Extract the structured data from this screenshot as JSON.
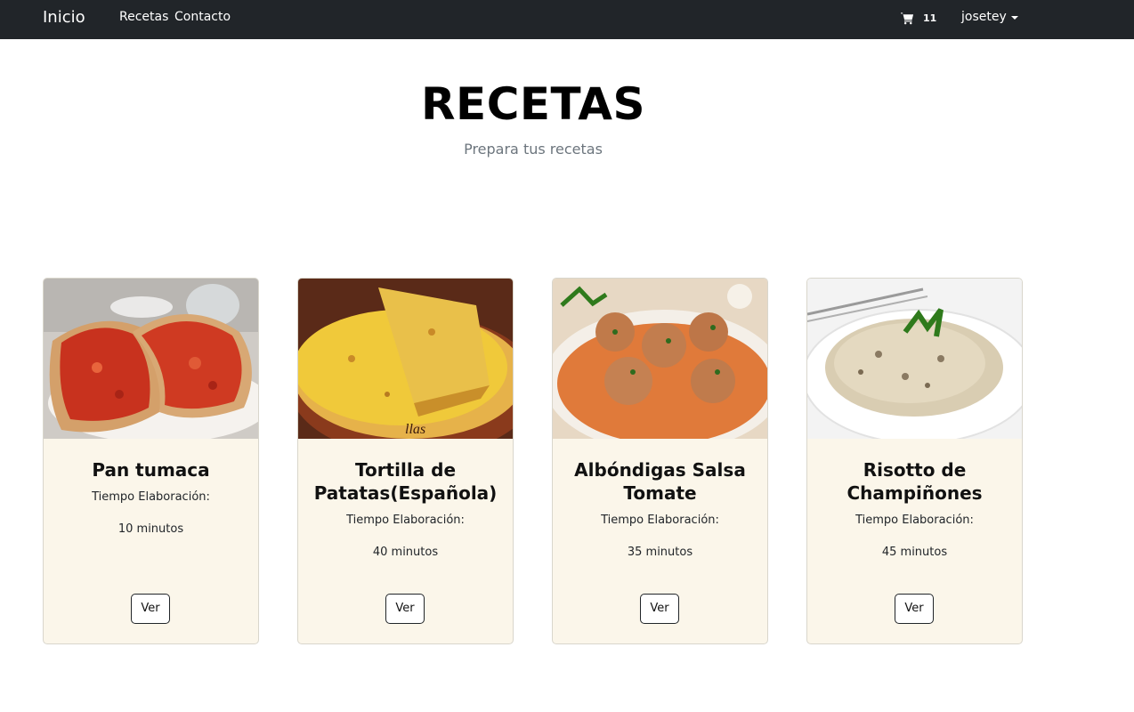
{
  "navbar": {
    "brand": "Inicio",
    "links": [
      "Recetas",
      "Contacto"
    ],
    "cart_icon": "shopping-cart-icon",
    "cart_count": "11",
    "user": "josetey"
  },
  "hero": {
    "title": "RECETAS",
    "subtitle": "Prepara tus recetas"
  },
  "recipes": [
    {
      "title": "Pan tumaca",
      "label": "Tiempo Elaboración:",
      "time": "10 minutos",
      "button": "Ver",
      "image": "pan-tumaca-photo"
    },
    {
      "title": "Tortilla de Patatas(Española)",
      "label": "Tiempo Elaboración:",
      "time": "40 minutos",
      "button": "Ver",
      "image": "tortilla-photo"
    },
    {
      "title": "Albóndigas Salsa Tomate",
      "label": "Tiempo Elaboración:",
      "time": "35 minutos",
      "button": "Ver",
      "image": "albondigas-photo"
    },
    {
      "title": "Risotto de Champiñones",
      "label": "Tiempo Elaboración:",
      "time": "45 minutos",
      "button": "Ver",
      "image": "risotto-photo"
    }
  ],
  "colors": {
    "navbar_bg": "#212529",
    "card_bg": "#fbf6ea"
  }
}
